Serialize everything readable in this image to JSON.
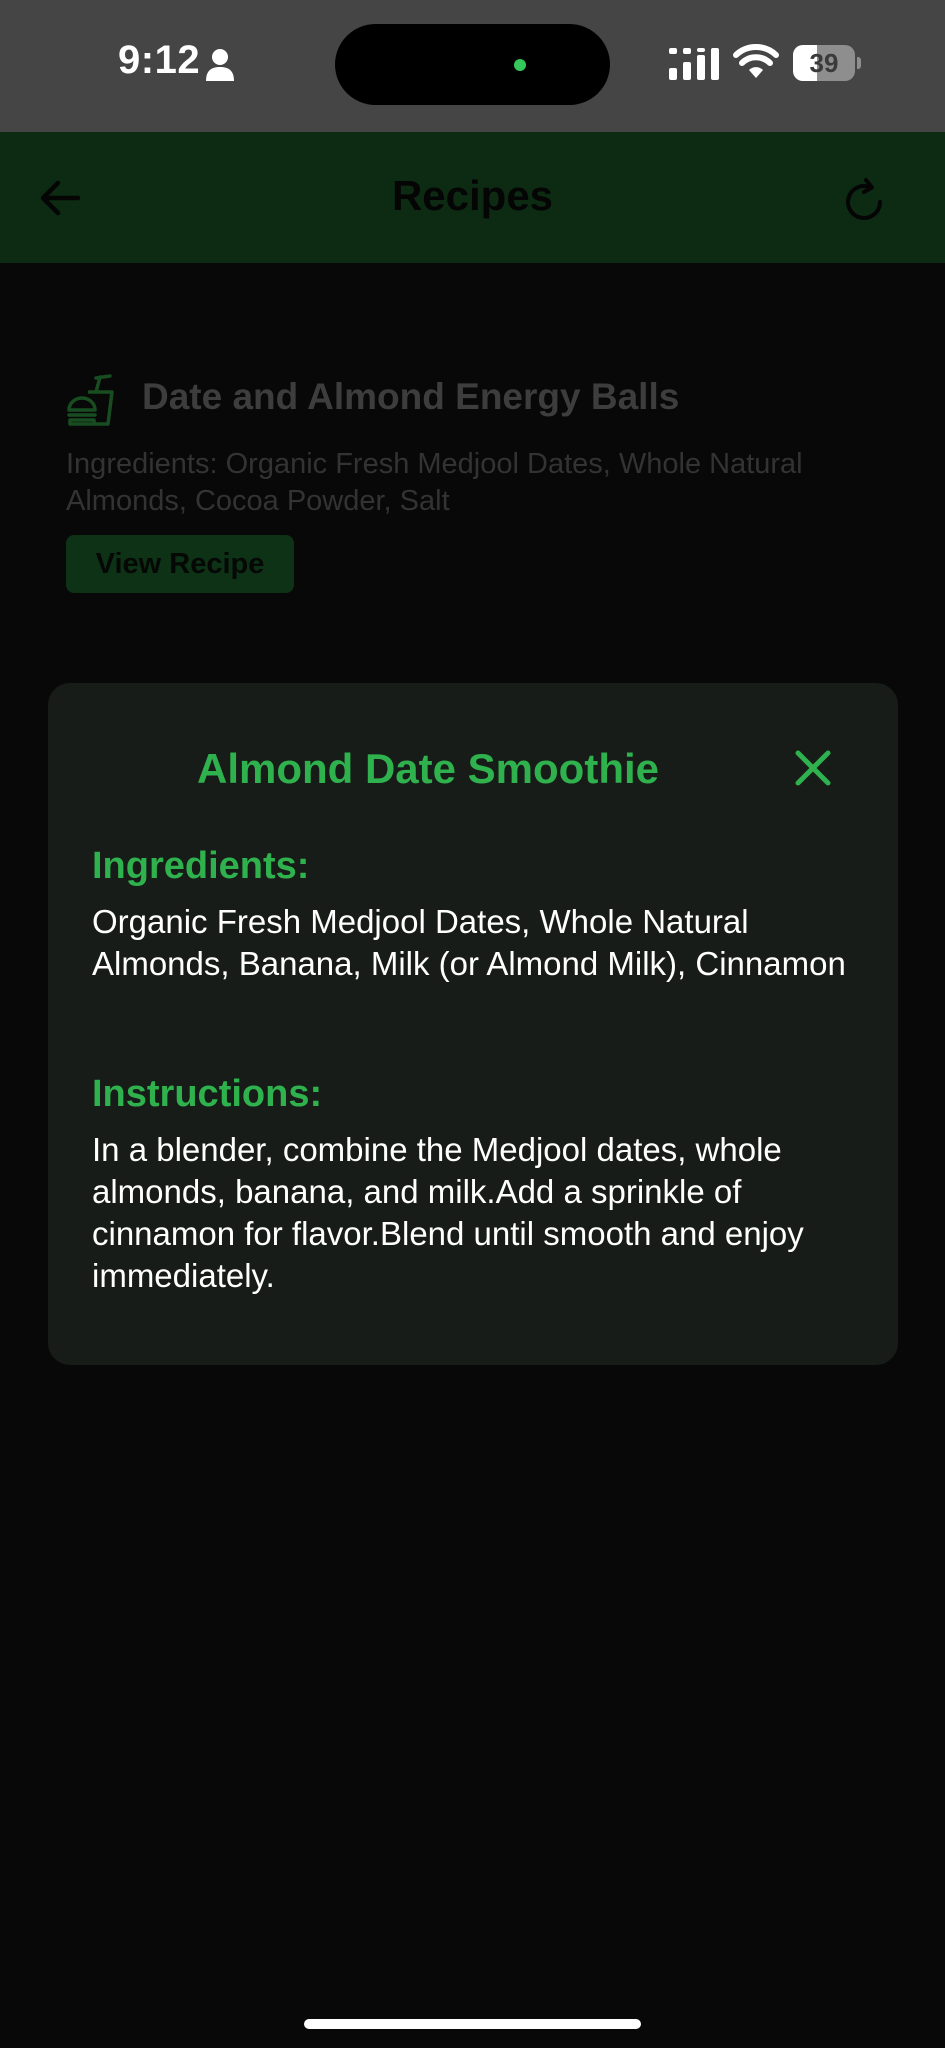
{
  "status_bar": {
    "time": "9:12",
    "battery_level": "39",
    "battery_fraction": 0.39,
    "icons": [
      "person-icon",
      "signal-icon",
      "wifi-icon",
      "battery-icon"
    ]
  },
  "header": {
    "title": "Recipes",
    "back_icon": "arrow-left-icon",
    "refresh_icon": "refresh-icon"
  },
  "recipe_list": [
    {
      "icon": "food-icon",
      "title": "Date and Almond Energy Balls",
      "ingredients": "Ingredients: Organic Fresh Medjool Dates, Whole Natural Almonds, Cocoa Powder, Salt",
      "button_label": "View Recipe"
    }
  ],
  "modal": {
    "title": "Almond Date Smoothie",
    "close_icon": "close-icon",
    "ingredients_heading": "Ingredients:",
    "ingredients": "Organic Fresh Medjool Dates, Whole Natural Almonds, Banana, Milk (or Almond Milk), Cinnamon",
    "instructions_heading": "Instructions:",
    "instructions": "In a blender, combine the Medjool dates, whole almonds, banana, and milk.Add a sprinkle of cinnamon for flavor.Blend until smooth and enjoy immediately."
  },
  "colors": {
    "accent": "#2fb14e",
    "header_bg": "#0c2b12",
    "modal_bg": "#181c18",
    "page_bg": "#070807"
  }
}
